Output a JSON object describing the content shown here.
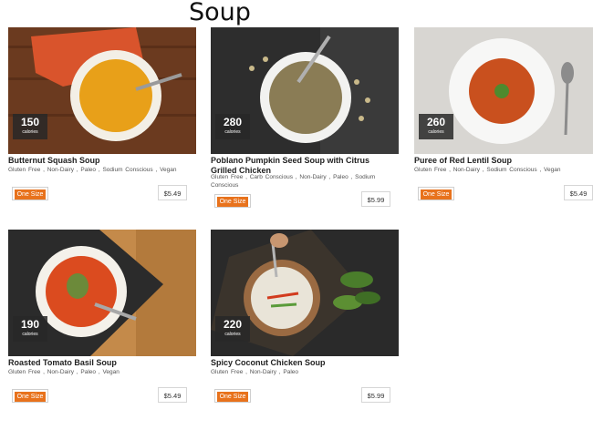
{
  "page": {
    "title": "Soup"
  },
  "colors": {
    "accent": "#e8721c"
  },
  "products": [
    {
      "name": "Butternut Squash Soup",
      "calories": "150",
      "calories_unit": "calories",
      "tags": "Gluten Free ,  Non-Dairy ,  Paleo ,  Sodium Conscious ,  Vegan",
      "size": "One Size",
      "price": "$5.49"
    },
    {
      "name": "Poblano Pumpkin Seed Soup with Citrus Grilled Chicken",
      "calories": "280",
      "calories_unit": "calories",
      "tags": "Gluten Free ,  Carb Conscious ,  Non-Dairy ,  Paleo ,  Sodium Conscious",
      "size": "One Size",
      "price": "$5.99"
    },
    {
      "name": "Puree of Red Lentil Soup",
      "calories": "260",
      "calories_unit": "calories",
      "tags": "Gluten Free ,  Non-Dairy ,  Sodium Conscious ,  Vegan",
      "size": "One Size",
      "price": "$5.49"
    },
    {
      "name": "Roasted Tomato Basil Soup",
      "calories": "190",
      "calories_unit": "calories",
      "tags": "Gluten Free ,  Non-Dairy ,  Paleo ,  Vegan",
      "size": "One Size",
      "price": "$5.49"
    },
    {
      "name": "Spicy Coconut Chicken Soup",
      "calories": "220",
      "calories_unit": "calories",
      "tags": "Gluten Free ,  Non-Dairy ,  Paleo",
      "size": "One Size",
      "price": "$5.99"
    }
  ]
}
